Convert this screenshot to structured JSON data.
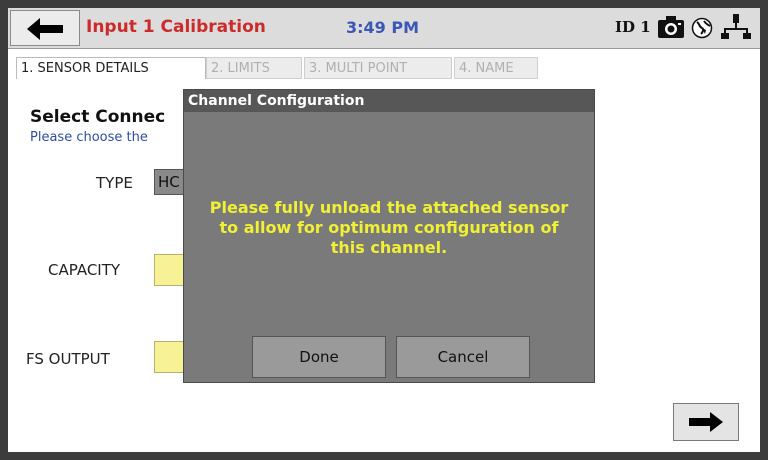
{
  "header": {
    "title": "Input 1 Calibration",
    "time": "3:49 PM",
    "device_id": "ID 1",
    "icons": [
      "back-arrow-icon",
      "camera-icon",
      "globe-icon",
      "network-icon"
    ]
  },
  "tabs": [
    {
      "label": "1. SENSOR DETAILS",
      "active": true
    },
    {
      "label": "2. LIMITS",
      "active": false
    },
    {
      "label": "3. MULTI POINT",
      "active": false
    },
    {
      "label": "4. NAME",
      "active": false
    }
  ],
  "form": {
    "section_title": "Select Connec",
    "section_subtitle": "Please choose the",
    "type_label": "TYPE",
    "type_value": "HC",
    "capacity_label": "CAPACITY",
    "capacity_value": "",
    "fs_output_label": "FS OUTPUT",
    "fs_output_value": ""
  },
  "dialog": {
    "title": "Channel Configuration",
    "message": "Please fully unload the attached sensor to allow for optimum configuration of this channel.",
    "done_label": "Done",
    "cancel_label": "Cancel"
  },
  "colors": {
    "title_red": "#cc2b2b",
    "time_blue": "#3a57b5",
    "message_yellow": "#f0f035",
    "field_yellow": "#f6f295",
    "dialog_gray": "#7a7a7a"
  }
}
